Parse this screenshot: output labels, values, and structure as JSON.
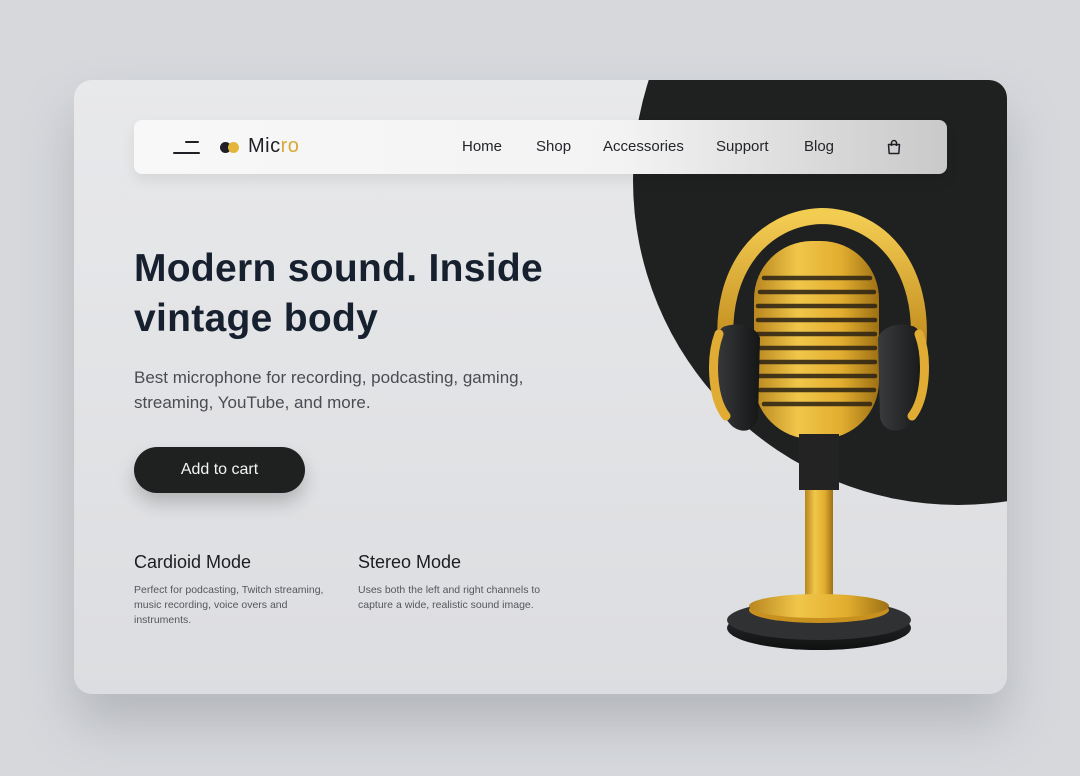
{
  "brand": {
    "name_main": "Mic",
    "name_accent": "ro",
    "accent_color": "#e3b53b"
  },
  "nav": {
    "items": [
      {
        "label": "Home"
      },
      {
        "label": "Shop"
      },
      {
        "label": "Accessories"
      },
      {
        "label": "Support"
      },
      {
        "label": "Blog"
      }
    ],
    "menu_icon": "menu-icon",
    "cart_icon": "shopping-bag-icon"
  },
  "hero": {
    "title": "Modern sound. Inside vintage body",
    "subtitle": "Best microphone for recording, podcasting, gaming, streaming, YouTube, and more.",
    "cta_label": "Add to cart"
  },
  "features": [
    {
      "title": "Cardioid Mode",
      "description": "Perfect for podcasting, Twitch streaming, music recording, voice overs and instruments."
    },
    {
      "title": "Stereo Mode",
      "description": "Uses both the left and right channels to capture a wide, realistic sound image."
    }
  ],
  "colors": {
    "dark": "#1f2020",
    "gold": "#e3b53b",
    "text": "#16202e",
    "background": "#d6d8dc"
  }
}
